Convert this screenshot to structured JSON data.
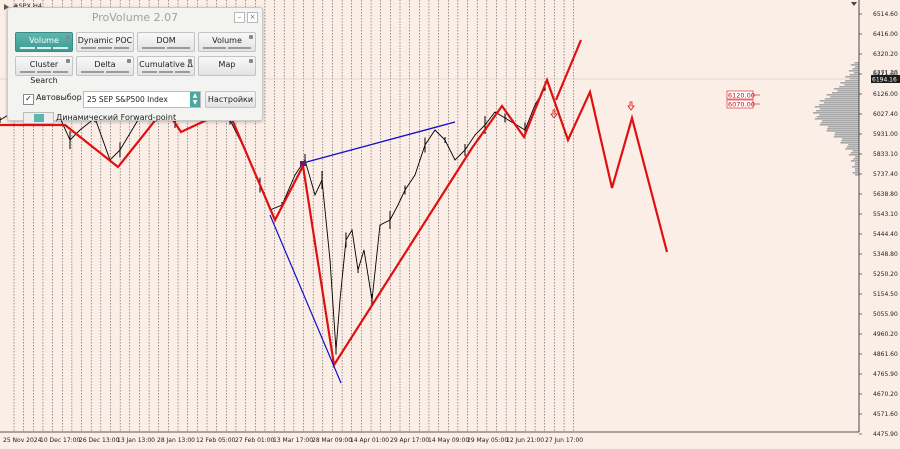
{
  "symbol_label": "#SPX,H4",
  "price_axis": {
    "ticks": [
      "6514.60",
      "6416.00",
      "6320.20",
      "6221.60",
      "6126.00",
      "6027.40",
      "5931.00",
      "5833.10",
      "5737.40",
      "5638.80",
      "5543.10",
      "5444.40",
      "5348.80",
      "5250.20",
      "5154.50",
      "5055.90",
      "4960.20",
      "4861.60",
      "4765.90",
      "4670.20",
      "4571.60",
      "4475.90"
    ],
    "current_price": "6194.16",
    "right_partial_label": "6271.30"
  },
  "time_axis": {
    "ticks": [
      "25 Nov 2024",
      "10 Dec 17:00",
      "26 Dec 13:00",
      "13 Jan 13:00",
      "28 Jan 13:00",
      "12 Feb 05:00",
      "27 Feb 01:00",
      "13 Mar 17:00",
      "28 Mar 09:00",
      "14 Apr 01:00",
      "29 Apr 17:00",
      "14 May 09:00",
      "29 May 05:00",
      "12 Jun 21:00",
      "27 Jun 17:00"
    ]
  },
  "price_labels": {
    "level_1": "6120.00",
    "level_2": "6070.00"
  },
  "panel": {
    "title": "ProVolume 2.07",
    "buttons": {
      "volume_profile": "Volume Profile",
      "dynamic_poc": "Dynamic POC",
      "dom": "DOM",
      "volume": "Volume",
      "cluster_search": "Cluster Search",
      "delta": "Delta",
      "cumulative_delta": "Cumulative Δ",
      "map": "Map",
      "settings": "Настройки"
    },
    "auto_select_label": "Автовыбор",
    "auto_select_checked": true,
    "instrument_value": "25 SEP S&P500 Index",
    "forward_point_label": "Динамический Forward-point"
  },
  "colors": {
    "background": "#fbeee6",
    "candles": "#000000",
    "zigzag": "#e01010",
    "trendline": "#1010cc",
    "accent": "#4aa89e"
  }
}
